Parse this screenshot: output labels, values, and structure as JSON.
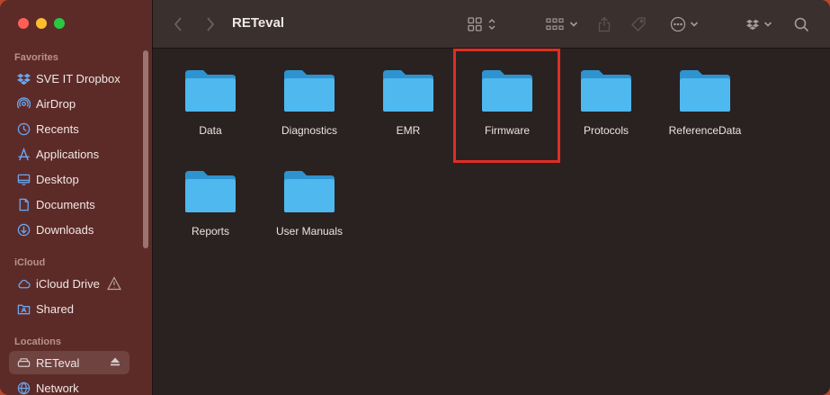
{
  "window": {
    "title": "RETeval"
  },
  "sidebar": {
    "sections": [
      {
        "label": "Favorites",
        "items": [
          {
            "label": "SVE IT Dropbox",
            "icon": "dropbox-icon"
          },
          {
            "label": "AirDrop",
            "icon": "airdrop-icon"
          },
          {
            "label": "Recents",
            "icon": "clock-icon"
          },
          {
            "label": "Applications",
            "icon": "applications-icon"
          },
          {
            "label": "Desktop",
            "icon": "desktop-icon"
          },
          {
            "label": "Documents",
            "icon": "document-icon"
          },
          {
            "label": "Downloads",
            "icon": "download-icon"
          }
        ]
      },
      {
        "label": "iCloud",
        "items": [
          {
            "label": "iCloud Drive",
            "icon": "cloud-icon"
          },
          {
            "label": "Shared",
            "icon": "shared-folder-icon"
          }
        ]
      },
      {
        "label": "Locations",
        "items": [
          {
            "label": "RETeval",
            "icon": "drive-icon",
            "selected": true
          },
          {
            "label": "Network",
            "icon": "network-icon"
          }
        ]
      }
    ]
  },
  "folders": [
    {
      "label": "Data"
    },
    {
      "label": "Diagnostics"
    },
    {
      "label": "EMR"
    },
    {
      "label": "Firmware",
      "highlighted": true
    },
    {
      "label": "Protocols"
    },
    {
      "label": "ReferenceData"
    },
    {
      "label": "Reports"
    },
    {
      "label": "User Manuals"
    }
  ],
  "colors": {
    "folder": "#4fb8ef",
    "highlight": "#e02d24",
    "sidebar": "#5c2b28"
  }
}
